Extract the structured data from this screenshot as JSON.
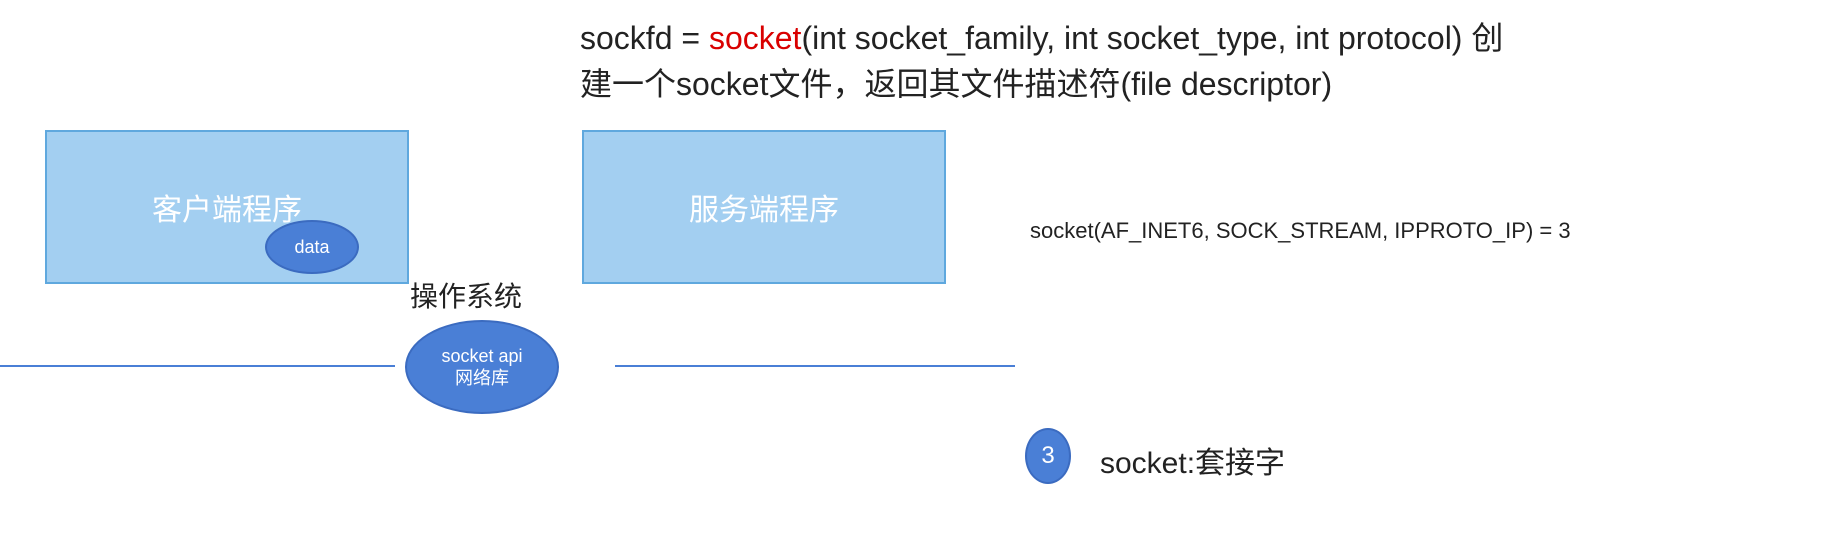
{
  "description": {
    "prefix": "sockfd = ",
    "keyword": "socket",
    "suffix1": "(int socket_family, int socket_type, int protocol) 创",
    "line2": "建一个socket文件，返回其文件描述符(file descriptor)"
  },
  "boxes": {
    "client_label": "客户端程序",
    "server_label": "服务端程序",
    "data_label": "data"
  },
  "os": {
    "label": "操作系统",
    "ellipse_line1": "socket api",
    "ellipse_line2": "网络库"
  },
  "example": {
    "call": "socket(AF_INET6, SOCK_STREAM, IPPROTO_IP) = 3"
  },
  "badge": {
    "number": "3",
    "label": "socket:套接字"
  }
}
